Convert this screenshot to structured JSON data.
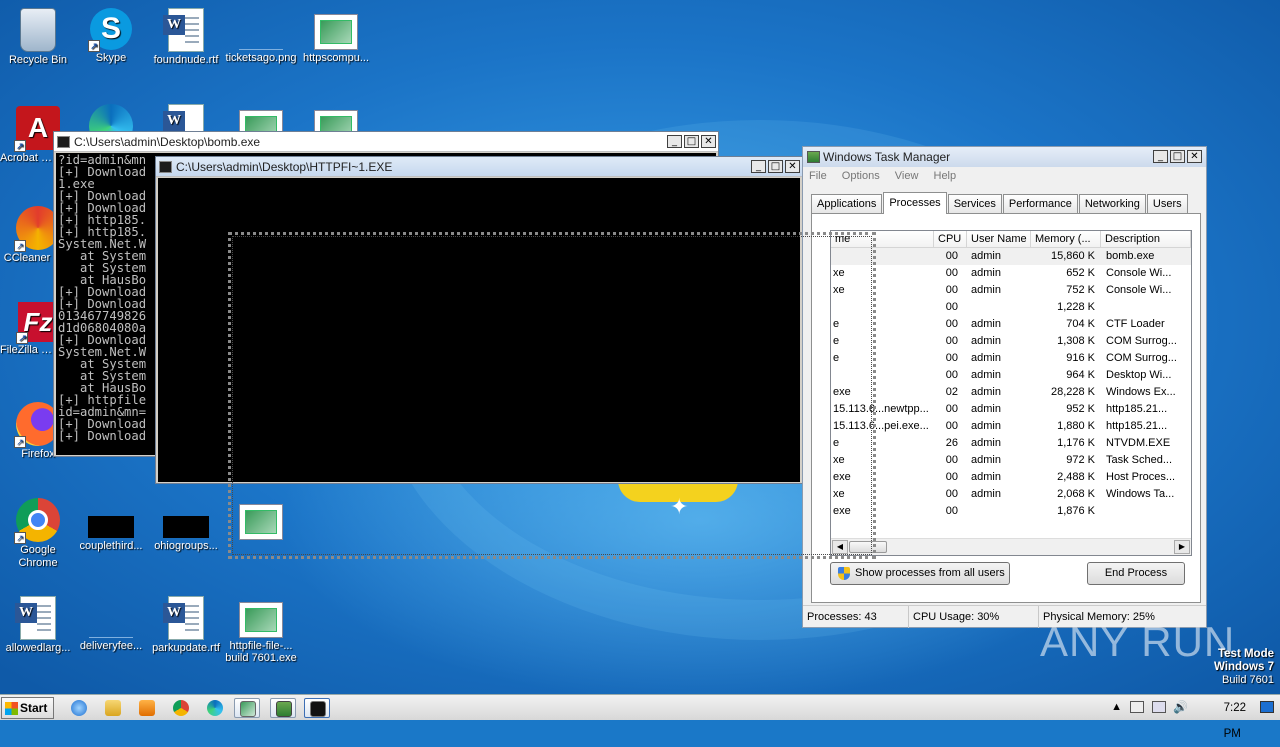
{
  "desktop_icons": [
    {
      "label": "Recycle Bin",
      "icon": "recycle-bin-icon"
    },
    {
      "label": "Skype",
      "icon": "skype-icon"
    },
    {
      "label": "foundnude.rtf",
      "icon": "word-document-icon"
    },
    {
      "label": "ticketsago.png",
      "icon": "blank-image-icon"
    },
    {
      "label": "httpscompu...",
      "icon": "image-file-icon"
    },
    {
      "label": "Acrobat Reader DC",
      "icon": "acrobat-icon"
    },
    {
      "label": "CCleaner",
      "icon": "ccleaner-icon"
    },
    {
      "label": "FileZilla Client",
      "icon": "filezilla-icon"
    },
    {
      "label": "Firefox",
      "icon": "firefox-icon"
    },
    {
      "label": "Google Chrome",
      "icon": "chrome-icon"
    },
    {
      "label": "couplethird...",
      "icon": "black-file-icon"
    },
    {
      "label": "ohiogroups...",
      "icon": "black-file-icon"
    },
    {
      "label": "allowedlarg...",
      "icon": "word-document-icon"
    },
    {
      "label": "deliveryfee...",
      "icon": "blank-image-icon"
    },
    {
      "label": "parkupdate.rtf",
      "icon": "word-document-icon"
    },
    {
      "label": "httpfile-file-... build 7601.exe",
      "icon": "image-file-icon"
    }
  ],
  "console_bomb": {
    "title": "C:\\Users\\admin\\Desktop\\bomb.exe",
    "lines": [
      "?id=admin&mn",
      "[+] Download",
      "1.exe",
      "[+] Download",
      "[+] Download",
      "[+] http185.",
      "[+] http185.",
      "System.Net.W",
      "   at System",
      "   at System",
      "   at HausBo",
      "[+] Download",
      "[+] Download",
      "013467749826",
      "d1d06804080a",
      "[+] Download",
      "System.Net.W",
      "   at System",
      "   at System",
      "   at HausBo",
      "[+] httpfile",
      "id=admin&mn=",
      "[+] Download",
      "[+] Download"
    ]
  },
  "console_httpfi": {
    "title": "C:\\Users\\admin\\Desktop\\HTTPFI~1.EXE"
  },
  "task_manager": {
    "title": "Windows Task Manager",
    "menu": [
      "File",
      "Options",
      "View",
      "Help"
    ],
    "tabs": [
      "Applications",
      "Processes",
      "Services",
      "Performance",
      "Networking",
      "Users"
    ],
    "selected_tab": "Processes",
    "columns": [
      "me",
      "CPU",
      "User Name",
      "Memory (...",
      "Description"
    ],
    "rows": [
      {
        "name": "",
        "cpu": "00",
        "user": "admin",
        "mem": "15,860 K",
        "desc": "bomb.exe"
      },
      {
        "name": "xe",
        "cpu": "00",
        "user": "admin",
        "mem": "652 K",
        "desc": "Console Wi..."
      },
      {
        "name": "xe",
        "cpu": "00",
        "user": "admin",
        "mem": "752 K",
        "desc": "Console Wi..."
      },
      {
        "name": "",
        "cpu": "00",
        "user": "",
        "mem": "1,228 K",
        "desc": ""
      },
      {
        "name": "e",
        "cpu": "00",
        "user": "admin",
        "mem": "704 K",
        "desc": "CTF Loader"
      },
      {
        "name": "e",
        "cpu": "00",
        "user": "admin",
        "mem": "1,308 K",
        "desc": "COM Surrog..."
      },
      {
        "name": "e",
        "cpu": "00",
        "user": "admin",
        "mem": "916 K",
        "desc": "COM Surrog..."
      },
      {
        "name": "",
        "cpu": "00",
        "user": "admin",
        "mem": "964 K",
        "desc": "Desktop Wi..."
      },
      {
        "name": "exe",
        "cpu": "02",
        "user": "admin",
        "mem": "28,228 K",
        "desc": "Windows Ex..."
      },
      {
        "name": "15.113.6...newtpp...",
        "cpu": "00",
        "user": "admin",
        "mem": "952 K",
        "desc": "http185.21..."
      },
      {
        "name": "15.113.6...pei.exe...",
        "cpu": "00",
        "user": "admin",
        "mem": "1,880 K",
        "desc": "http185.21..."
      },
      {
        "name": "e",
        "cpu": "26",
        "user": "admin",
        "mem": "1,176 K",
        "desc": "NTVDM.EXE"
      },
      {
        "name": "xe",
        "cpu": "00",
        "user": "admin",
        "mem": "972 K",
        "desc": "Task Sched..."
      },
      {
        "name": "exe",
        "cpu": "00",
        "user": "admin",
        "mem": "2,488 K",
        "desc": "Host Proces..."
      },
      {
        "name": "xe",
        "cpu": "00",
        "user": "admin",
        "mem": "2,068 K",
        "desc": "Windows Ta..."
      },
      {
        "name": "exe",
        "cpu": "00",
        "user": "",
        "mem": "1,876 K",
        "desc": ""
      }
    ],
    "show_all_label": "Show processes from all users",
    "end_process_label": "End Process",
    "status": {
      "processes": "Processes: 43",
      "cpu": "CPU Usage: 30%",
      "memory": "Physical Memory: 25%"
    }
  },
  "taskbar": {
    "start_label": "Start",
    "apps": [
      "ie-icon",
      "explorer-icon",
      "media-player-icon",
      "chrome-icon",
      "edge-icon",
      "image-viewer-icon",
      "task-manager-icon",
      "console-icon"
    ],
    "clock": "7:22 PM"
  },
  "test_mode": {
    "line1": "Test Mode",
    "line2": "Windows 7",
    "line3": "Build 7601"
  },
  "watermark": "ANY RUN"
}
